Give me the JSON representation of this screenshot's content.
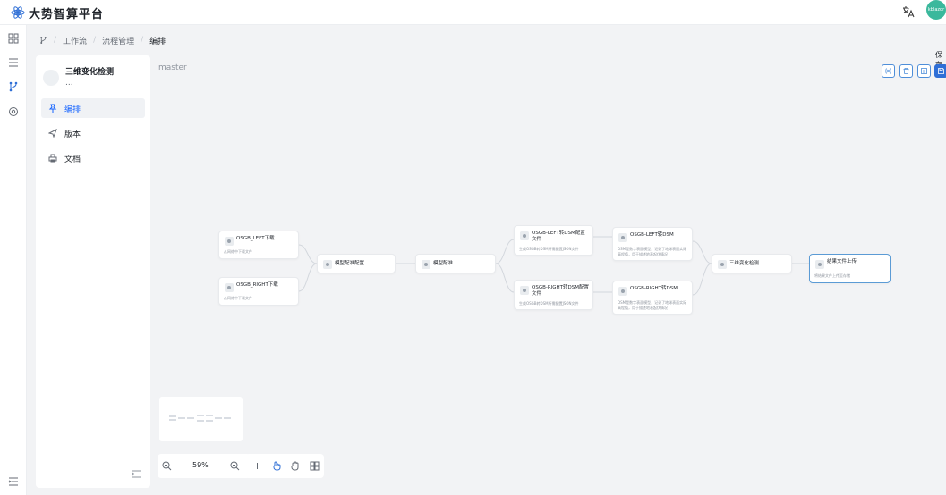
{
  "app": {
    "title": "大势智算平台",
    "avatar_text": "kblazor",
    "accent": "#1664ff",
    "avatar_color": "#3bb89c"
  },
  "breadcrumb": {
    "items": [
      "工作流",
      "流程管理",
      "编排"
    ]
  },
  "project": {
    "name": "三维变化检测",
    "more": "...",
    "menu": [
      {
        "label": "编排",
        "icon": "pin-icon",
        "active": true
      },
      {
        "label": "版本",
        "icon": "send-icon",
        "active": false
      },
      {
        "label": "文档",
        "icon": "print-icon",
        "active": false
      }
    ]
  },
  "canvas": {
    "branch": "master",
    "save_tooltip": "保存",
    "toolbar_icons": [
      "variable-icon",
      "trash-icon",
      "copy-icon",
      "save-icon"
    ]
  },
  "nodes": [
    {
      "id": "n1",
      "title": "OSGB_LEFT下载",
      "desc": "从网络中下载文件"
    },
    {
      "id": "n2",
      "title": "OSGB_RIGHT下载",
      "desc": "从网络中下载文件"
    },
    {
      "id": "n3",
      "title": "模型配准配置",
      "desc": ""
    },
    {
      "id": "n4",
      "title": "模型配准",
      "desc": ""
    },
    {
      "id": "n5",
      "title": "OSGB-LEFT转DSM配置文件",
      "desc": "生成OSGB转DSM所需配置JSON文件"
    },
    {
      "id": "n6",
      "title": "OSGB-RIGHT转DSM配置文件",
      "desc": "生成OSGB转DSM所需配置JSON文件"
    },
    {
      "id": "n7",
      "title": "OSGB-LEFT转DSM",
      "desc": "DSM是数字表面模型，记录了地球表面实际高程值，用于描述地表起伏情况"
    },
    {
      "id": "n8",
      "title": "OSGB-RIGHT转DSM",
      "desc": "DSM是数字表面模型，记录了地球表面实际高程值，用于描述地表起伏情况"
    },
    {
      "id": "n9",
      "title": "三维变化检测",
      "desc": ""
    },
    {
      "id": "n10",
      "title": "结果文件上传",
      "desc": "将结果文件上传至存储"
    }
  ],
  "zoom": {
    "value": "59%"
  },
  "icons": {
    "logo": "logo-icon",
    "language": "translate-icon",
    "rail": [
      "grid-icon",
      "list-icon",
      "workflow-icon",
      "settings-icon",
      "rail-menu-icon"
    ],
    "zoom_out": "zoom-out-icon",
    "zoom_in": "zoom-in-icon",
    "add": "add-icon",
    "pointer": "pointer-icon",
    "hand": "hand-icon",
    "layout": "layout-icon"
  }
}
